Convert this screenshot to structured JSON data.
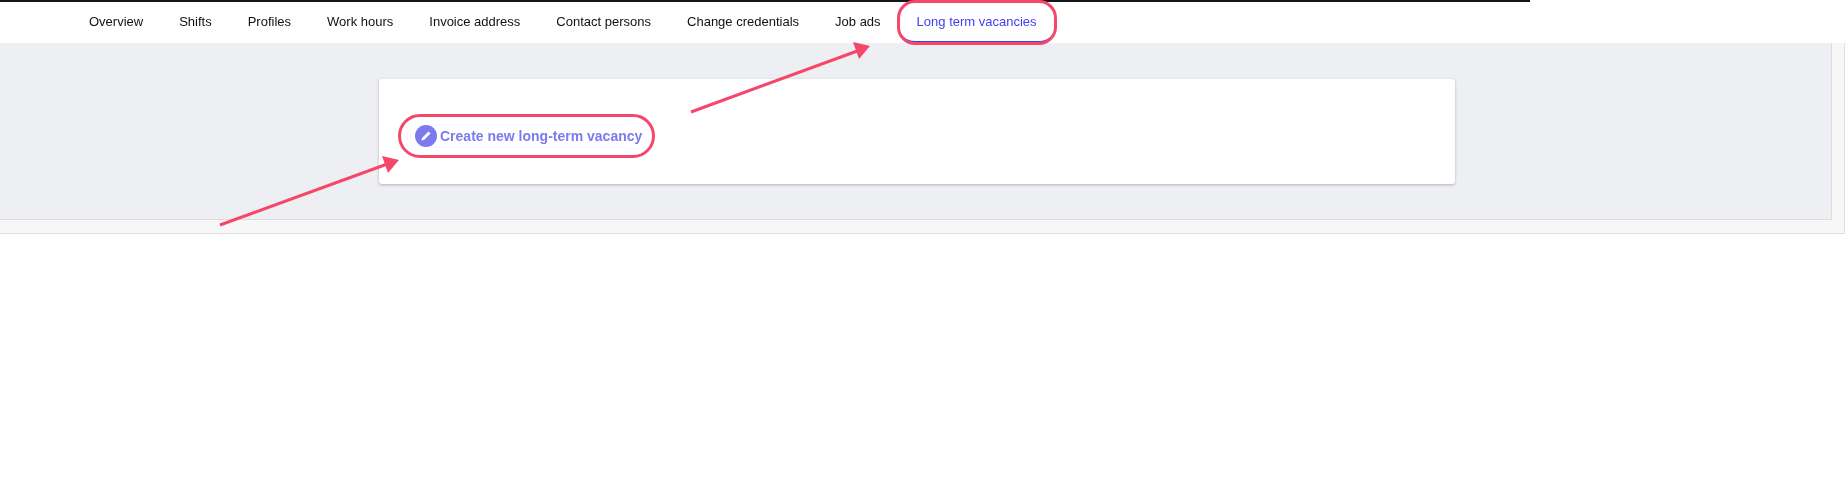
{
  "tabs": [
    {
      "label": "Overview",
      "selected": false,
      "highlighted": false
    },
    {
      "label": "Shifts",
      "selected": false,
      "highlighted": false
    },
    {
      "label": "Profiles",
      "selected": false,
      "highlighted": false
    },
    {
      "label": "Work hours",
      "selected": false,
      "highlighted": false
    },
    {
      "label": "Invoice address",
      "selected": false,
      "highlighted": false
    },
    {
      "label": "Contact persons",
      "selected": false,
      "highlighted": false
    },
    {
      "label": "Change credentials",
      "selected": false,
      "highlighted": false
    },
    {
      "label": "Job ads",
      "selected": false,
      "highlighted": false
    },
    {
      "label": "Long term vacancies",
      "selected": true,
      "highlighted": true
    }
  ],
  "card": {
    "create_button": {
      "label": "Create new long-term vacancy",
      "highlighted": true
    }
  }
}
